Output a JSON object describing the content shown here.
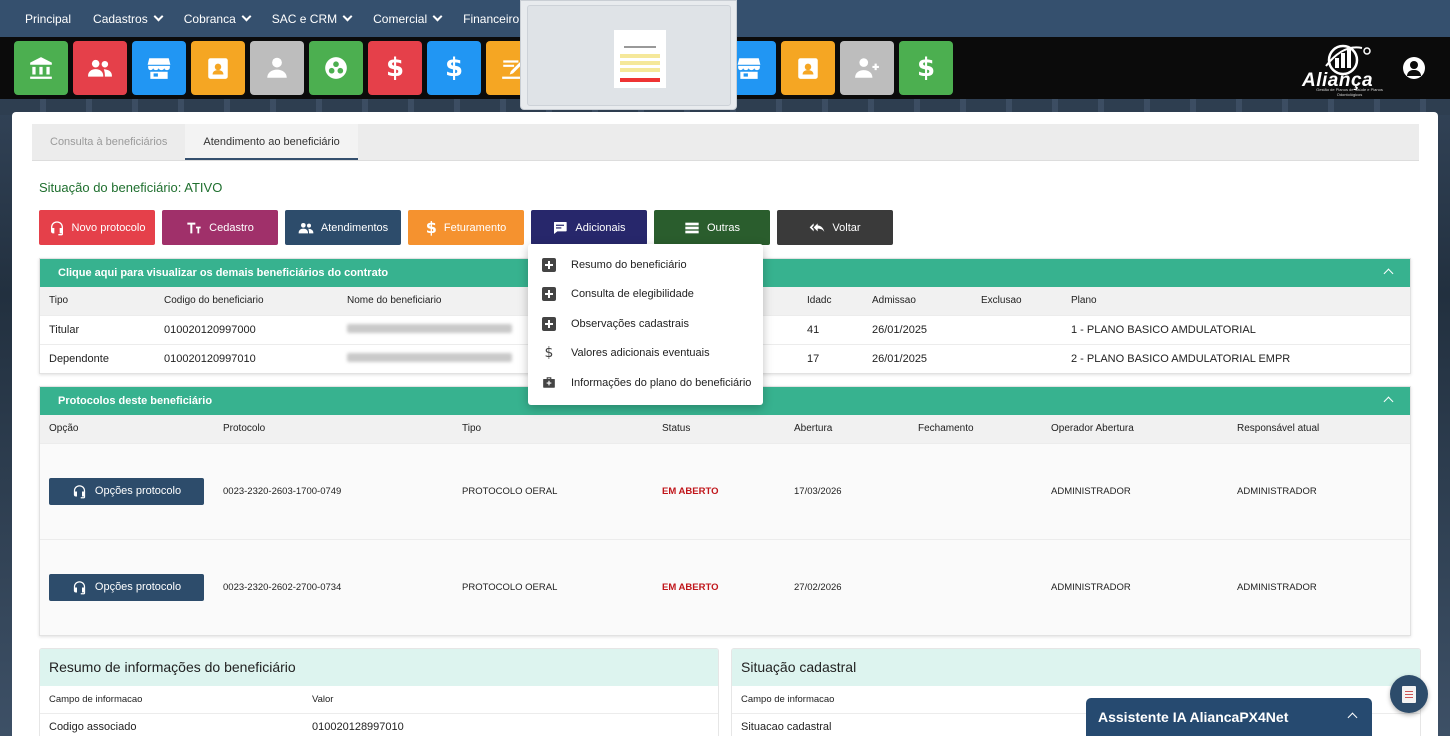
{
  "nav": {
    "items": [
      {
        "label": "Principal",
        "dropdown": false
      },
      {
        "label": "Cadastros",
        "dropdown": true
      },
      {
        "label": "Cobranca",
        "dropdown": true
      },
      {
        "label": "SAC e CRM",
        "dropdown": true
      },
      {
        "label": "Comercial",
        "dropdown": true
      },
      {
        "label": "Financeiro",
        "dropdown": true
      }
    ]
  },
  "iconbar": {
    "tiles": [
      {
        "icon": "bank-icon",
        "color": "#4caf50"
      },
      {
        "icon": "users-icon",
        "color": "#e5404a"
      },
      {
        "icon": "store-icon",
        "color": "#2196f3"
      },
      {
        "icon": "id-badge-icon",
        "color": "#f5a623"
      },
      {
        "icon": "user-icon",
        "color": "#bdbdbd"
      },
      {
        "icon": "soccer-ball-icon",
        "color": "#4caf50"
      },
      {
        "icon": "dollar-icon",
        "color": "#e5404a"
      },
      {
        "icon": "dollar-icon",
        "color": "#2196f3"
      },
      {
        "icon": "signature-icon",
        "color": "#f5a623"
      },
      {
        "icon": "store-icon",
        "color": "#2196f3"
      },
      {
        "icon": "id-badge-icon",
        "color": "#f5a623"
      },
      {
        "icon": "user-group-icon",
        "color": "#bdbdbd"
      },
      {
        "icon": "dollar-icon",
        "color": "#4caf50"
      }
    ],
    "logo_word": "Aliança",
    "logo_tag": "Gestão de Planos de Saúde e Planos Odontológicos"
  },
  "tabs": [
    {
      "label": "Consulta à beneficiários",
      "active": false
    },
    {
      "label": "Atendimento ao beneficiário",
      "active": true
    }
  ],
  "status": {
    "label": "Situação do beneficiário: ATIVO"
  },
  "buttons": [
    {
      "label": "Novo protocolo",
      "icon": "headset-icon",
      "color": "#e5404a"
    },
    {
      "label": "Cedastro",
      "icon": "text-height-icon",
      "color": "#a0306a"
    },
    {
      "label": "Atendimentos",
      "icon": "users-icon",
      "color": "#2d4c6b"
    },
    {
      "label": "Feturamento",
      "icon": "dollar-icon",
      "color": "#f5922f"
    },
    {
      "label": "Adicionais",
      "icon": "comment-alt-icon",
      "color": "#27276b"
    },
    {
      "label": "Outras",
      "icon": "list-icon",
      "color": "#2a5d2d"
    },
    {
      "label": "Voltar",
      "icon": "reply-all-icon",
      "color": "#3a3a3a"
    }
  ],
  "beneficiaries": {
    "title": "Clique aqui para visualizar os demais beneficiários do contrato",
    "headers": [
      "Tipo",
      "Codigo do beneficiario",
      "Nome do beneficiario",
      "Idadc",
      "Admissao",
      "Exclusao",
      "Plano"
    ],
    "rows": [
      {
        "tipo": "Titular",
        "codigo": "010020120997000",
        "idade": "41",
        "admissao": "26/01/2025",
        "exclusao": "",
        "plano": "1 - PLANO BASICO AMDULATORIAL"
      },
      {
        "tipo": "Dependonte",
        "codigo": "010020120997010",
        "idade": "17",
        "admissao": "26/01/2025",
        "exclusao": "",
        "plano": "2 - PLANO BASICO AMDULATORIAL EMPR"
      }
    ]
  },
  "protocols": {
    "title": "Protocolos deste beneficiário",
    "headers": [
      "Opção",
      "Protocolo",
      "Tipo",
      "Status",
      "Abertura",
      "Fechamento",
      "Operador Abertura",
      "Responsável atual"
    ],
    "button_label": "Opções protocolo",
    "rows": [
      {
        "protocolo": "0023-2320-2603-1700-0749",
        "tipo": "PROTOCOLO OERAL",
        "status": "EM ABERTO",
        "abertura": "17/03/2026",
        "fechamento": "",
        "operador": "ADMINISTRADOR",
        "responsavel": "ADMINISTRADOR"
      },
      {
        "protocolo": "0023-2320-2602-2700-0734",
        "tipo": "PROTOCOLO OERAL",
        "status": "EM ABERTO",
        "abertura": "27/02/2026",
        "fechamento": "",
        "operador": "ADMINISTRADOR",
        "responsavel": "ADMINISTRADOR"
      }
    ]
  },
  "resumo": {
    "title": "Resumo de informações do beneficiário",
    "headers": [
      "Campo de informacao",
      "Valor"
    ],
    "rows": [
      {
        "campo": "Codigo associado",
        "valor": "010020128997010"
      }
    ]
  },
  "situacao": {
    "title": "Situação cadastral",
    "headers": [
      "Campo de informacao",
      ""
    ],
    "rows": [
      {
        "campo": "Situacao cadastral",
        "valor": ""
      }
    ]
  },
  "dropdown": {
    "items": [
      {
        "label": "Resumo do beneficiário",
        "icon": "plus-square-icon"
      },
      {
        "label": "Consulta de elegibilidade",
        "icon": "plus-square-icon"
      },
      {
        "label": "Observações cadastrais",
        "icon": "plus-square-icon"
      },
      {
        "label": "Valores adicionais eventuais",
        "icon": "dollar-icon"
      },
      {
        "label": "Informações do plano do beneficiário",
        "icon": "medical-kit-icon"
      }
    ]
  },
  "assistant": {
    "label": "Assistente IA AliancaPX4Net"
  }
}
